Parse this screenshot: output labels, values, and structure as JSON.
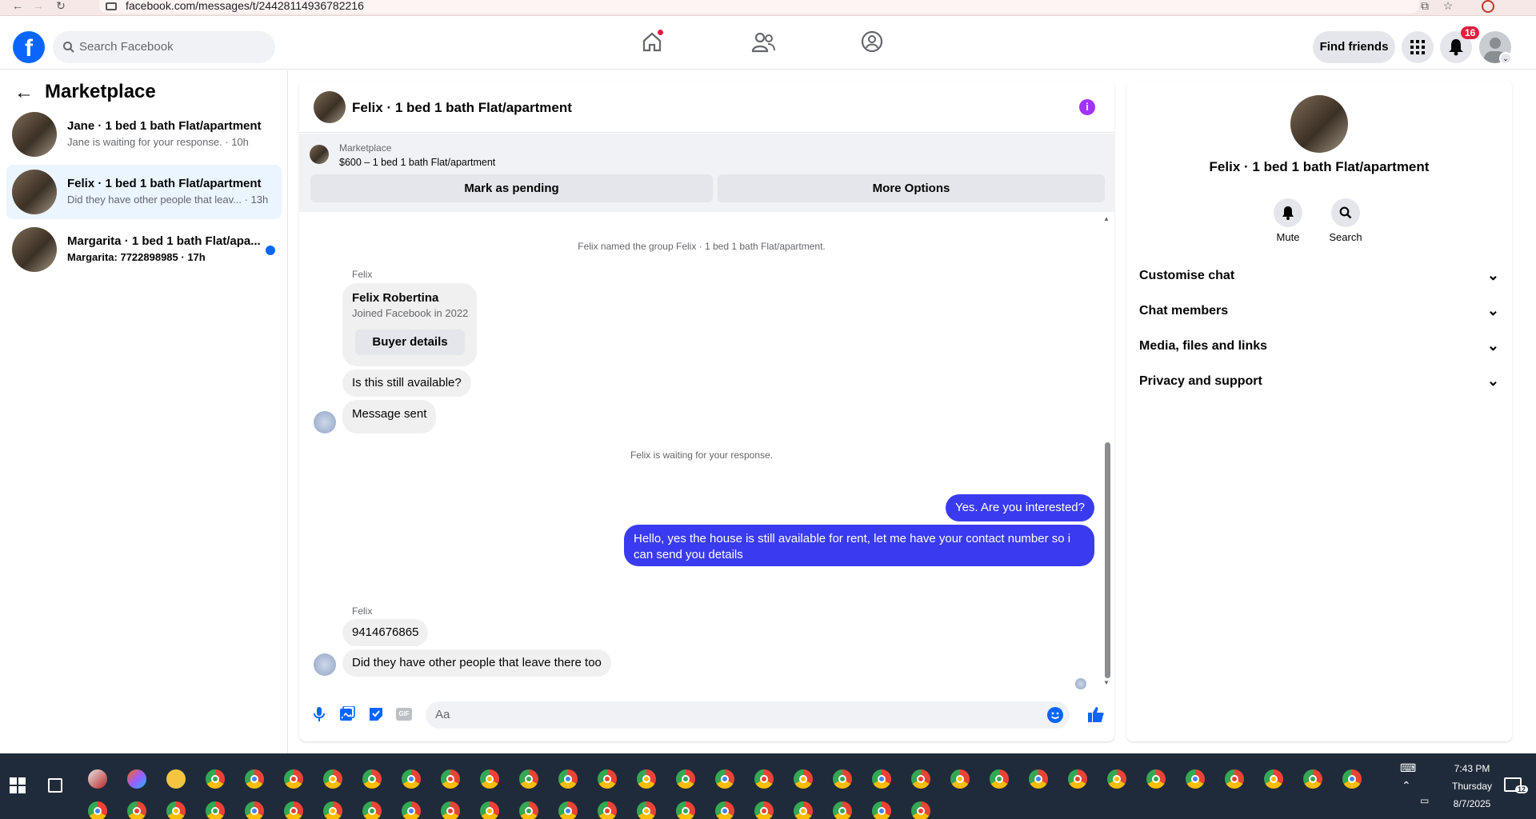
{
  "browser": {
    "url": "facebook.com/messages/t/24428114936782216"
  },
  "header": {
    "search_placeholder": "Search Facebook",
    "find_friends": "Find friends",
    "notifications_count": "16"
  },
  "left": {
    "title": "Marketplace",
    "conversations": [
      {
        "name": "Jane · 1 bed 1 bath Flat/apartment",
        "preview": "Jane is waiting for your response. · 10h"
      },
      {
        "name": "Felix · 1 bed 1 bath Flat/apartment",
        "preview": "Did they have other people that leav... · 13h"
      },
      {
        "name": "Margarita · 1 bed 1 bath Flat/apa...",
        "preview": "Margarita: 7722898985 · 17h"
      }
    ]
  },
  "chat": {
    "title": "Felix · 1 bed 1 bath Flat/apartment",
    "listing_label": "Marketplace",
    "listing_price": "$600 – 1 bed 1 bath Flat/apartment",
    "mark_pending": "Mark as pending",
    "more_options": "More Options",
    "system_named": "Felix named the group Felix · 1 bed 1 bath Flat/apartment.",
    "sender1": "Felix",
    "card_name": "Felix Robertina",
    "card_sub": "Joined Facebook in 2022",
    "card_button": "Buyer details",
    "msg_available": "Is this still available?",
    "msg_sent": "Message sent",
    "system_waiting": "Felix is waiting for your response.",
    "out1": "Yes. Are you interested?",
    "out2_line1": "Hello, yes the house is still available for rent, let me have your contact number so i",
    "out2_line2": "can send you details",
    "sender2": "Felix",
    "in_phone": "9414676865",
    "in_last": "Did they have other people that leave there too",
    "composer_placeholder": "Aa"
  },
  "right": {
    "title": "Felix · 1 bed 1 bath Flat/apartment",
    "mute": "Mute",
    "search": "Search",
    "sections": [
      "Customise chat",
      "Chat members",
      "Media, files and links",
      "Privacy and support"
    ]
  },
  "taskbar": {
    "time": "7:43 PM",
    "day": "Thursday",
    "date": "8/7/2025",
    "notif_count": "12"
  },
  "colors": {
    "fb_blue": "#0866ff",
    "outgoing_bubble": "#3a3bf0",
    "info_purple": "#a033ff",
    "badge_red": "#e41e3f"
  }
}
